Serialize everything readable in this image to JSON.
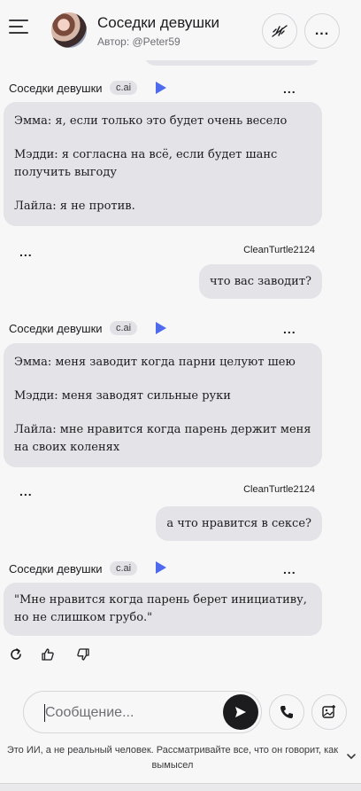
{
  "header": {
    "title": "Соседки девушки",
    "author": "Автор: @Peter59",
    "more_label": "..."
  },
  "messages": [
    {
      "type": "bot",
      "sender": "Соседки девушки",
      "badge": "c.ai",
      "more": "...",
      "lines": [
        "Эмма: я, если только это будет очень весело",
        "Мэдди: я согласна на всё, если будет шанс получить выгоду",
        "Лайла: я не против."
      ]
    },
    {
      "type": "user",
      "sender": "CleanTurtle2124",
      "more": "...",
      "text": "что вас заводит?"
    },
    {
      "type": "bot",
      "sender": "Соседки девушки",
      "badge": "c.ai",
      "more": "...",
      "lines": [
        "Эмма: меня заводит когда парни целуют шею",
        "Мэдди: меня заводят сильные руки",
        "Лайла: мне нравится когда парень держит меня на своих коленях"
      ]
    },
    {
      "type": "user",
      "sender": "CleanTurtle2124",
      "more": "...",
      "text": "а что нравится в сексе?"
    },
    {
      "type": "bot",
      "sender": "Соседки девушки",
      "badge": "c.ai",
      "more": "...",
      "lines": [
        "\"Мне нравится когда парень берет инициативу, но не слишком грубо.\""
      ]
    }
  ],
  "composer": {
    "placeholder": "Сообщение..."
  },
  "disclaimer": "Это ИИ, а не реальный человек. Рассматривайте все, что он говорит, как вымысел",
  "colors": {
    "accent": "#4f6bed",
    "bubble": "#e4e4e8",
    "background": "#f7f7f8"
  }
}
